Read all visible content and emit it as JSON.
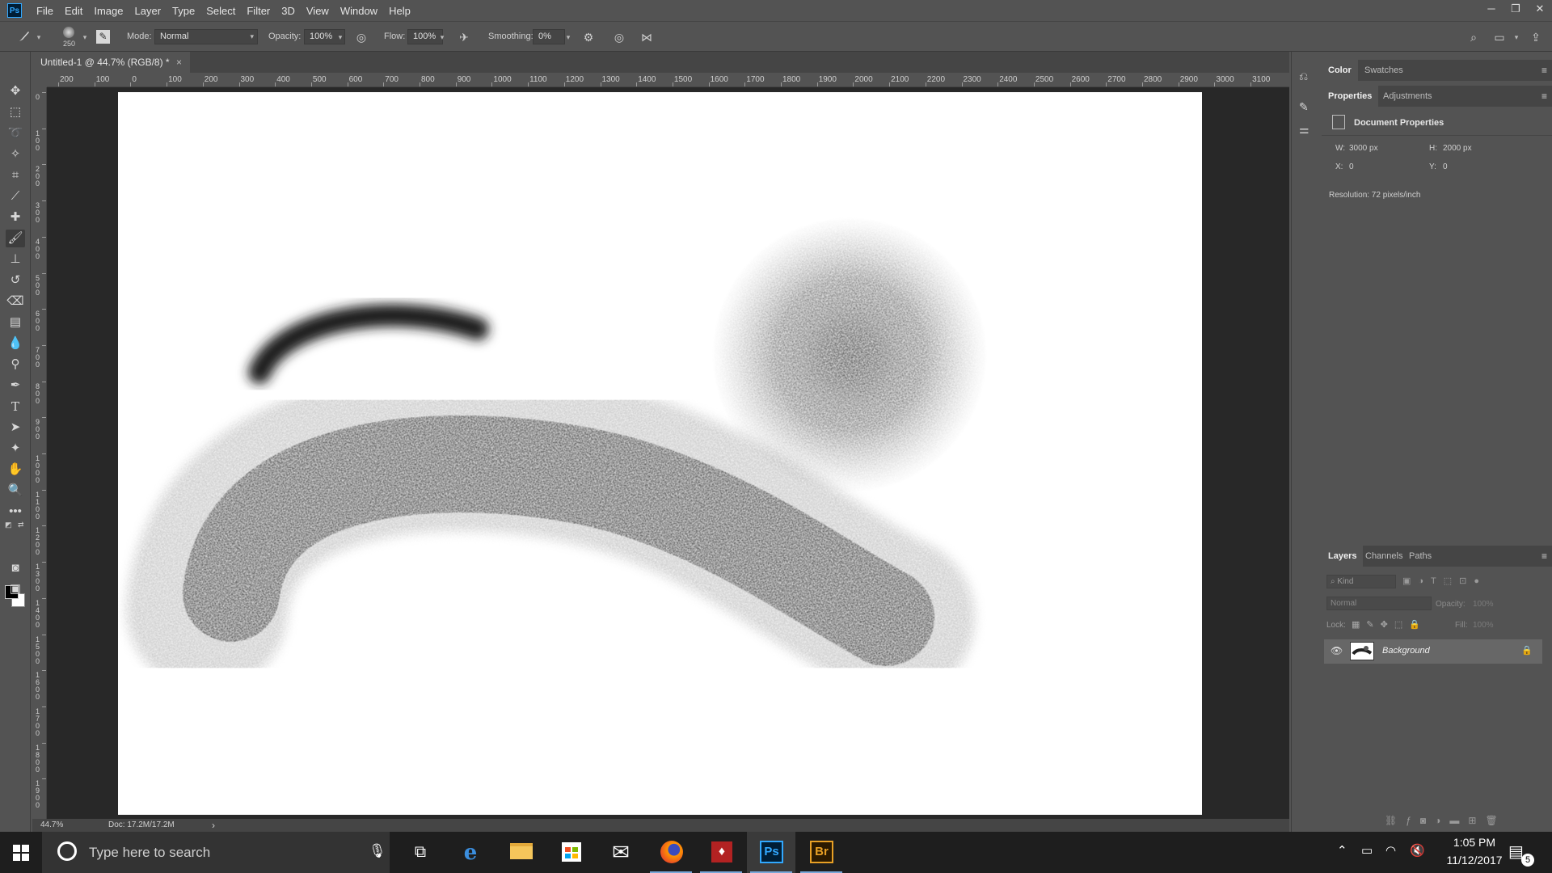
{
  "app": {
    "logo_text": "Ps"
  },
  "menu": [
    "File",
    "Edit",
    "Image",
    "Layer",
    "Type",
    "Select",
    "Filter",
    "3D",
    "View",
    "Window",
    "Help"
  ],
  "window_controls": {
    "minimize": "─",
    "restore": "❐",
    "close": "✕"
  },
  "options": {
    "brush_size": "250",
    "mode_label": "Mode:",
    "mode_value": "Normal",
    "opacity_label": "Opacity:",
    "opacity_value": "100%",
    "flow_label": "Flow:",
    "flow_value": "100%",
    "smoothing_label": "Smoothing:",
    "smoothing_value": "0%"
  },
  "document": {
    "tab_title": "Untitled-1 @ 44.7% (RGB/8) *",
    "close": "×",
    "zoom": "44.7%",
    "doc_info": "Doc: 17.2M/17.2M",
    "status_arrow": "›"
  },
  "ruler": {
    "top_ticks": [
      "200",
      "100",
      "0",
      "100",
      "200",
      "300",
      "400",
      "500",
      "600",
      "700",
      "800",
      "900",
      "1000",
      "1100",
      "1200",
      "1300",
      "1400",
      "1500",
      "1600",
      "1700",
      "1800",
      "1900",
      "2000",
      "2100",
      "2200",
      "2300",
      "2400",
      "2500",
      "2600",
      "2700",
      "2800",
      "2900",
      "3000",
      "3100"
    ],
    "left_ticks": [
      "0",
      "100",
      "200",
      "300",
      "400",
      "500",
      "600",
      "700",
      "800",
      "900",
      "1000",
      "1100",
      "1200",
      "1300",
      "1400",
      "1500",
      "1600",
      "1700",
      "1800",
      "1900"
    ]
  },
  "panels": {
    "color_tabs": [
      "Color",
      "Swatches"
    ],
    "properties_tabs": [
      "Properties",
      "Adjustments"
    ],
    "properties_title": "Document Properties",
    "w_label": "W:",
    "w_value": "3000 px",
    "h_label": "H:",
    "h_value": "2000 px",
    "x_label": "X:",
    "x_value": "0",
    "y_label": "Y:",
    "y_value": "0",
    "resolution": "Resolution: 72 pixels/inch",
    "layers_tabs": [
      "Layers",
      "Channels",
      "Paths"
    ],
    "kind_placeholder": "Kind",
    "blend_mode": "Normal",
    "opacity_label": "Opacity:",
    "opacity_value": "100%",
    "lock_label": "Lock:",
    "fill_label": "Fill:",
    "fill_value": "100%",
    "layer_name": "Background"
  },
  "taskbar": {
    "search_placeholder": "Type here to search",
    "time": "1:05 PM",
    "date": "11/12/2017",
    "notification_count": "5",
    "apps": [
      "task-view",
      "edge",
      "file-explorer",
      "store",
      "mail",
      "firefox",
      "app-red",
      "photoshop",
      "bridge"
    ]
  }
}
